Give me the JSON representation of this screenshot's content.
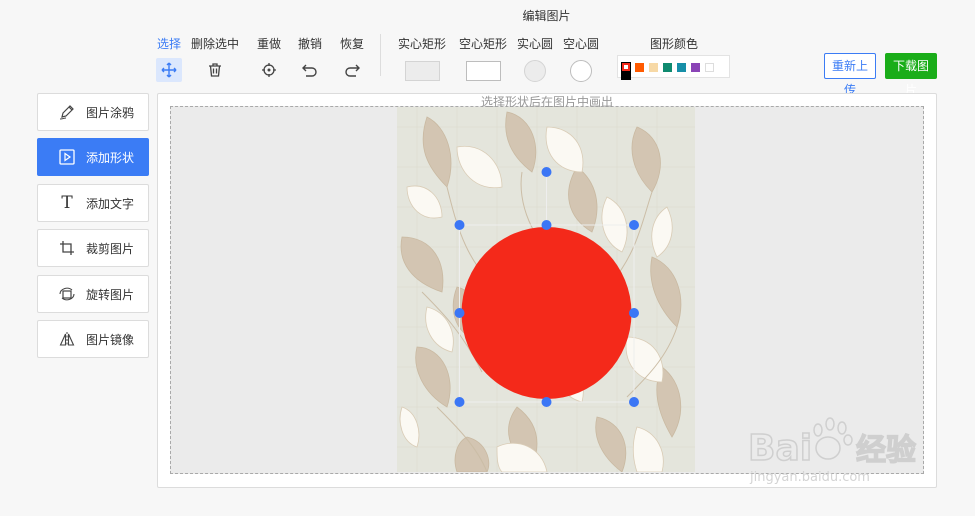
{
  "app": {
    "title": "编辑图片"
  },
  "toolbar": {
    "tools": [
      {
        "label": "选择",
        "icon": "move-icon",
        "active": true
      },
      {
        "label": "删除选中",
        "icon": "trash-icon"
      },
      {
        "label": "重做",
        "icon": "crosshair-icon"
      },
      {
        "label": "撤销",
        "icon": "undo-icon"
      },
      {
        "label": "恢复",
        "icon": "redo-icon"
      }
    ],
    "shapes": [
      {
        "label": "实心矩形",
        "icon": "filled-rect-icon"
      },
      {
        "label": "空心矩形",
        "icon": "hollow-rect-icon"
      },
      {
        "label": "实心圆",
        "icon": "filled-circle-icon"
      },
      {
        "label": "空心圆",
        "icon": "hollow-circle-icon"
      }
    ],
    "color_label": "图形颜色",
    "colors": [
      "#000000",
      "#ff5a00",
      "#f7d9a6",
      "#0f8a6f",
      "#178fa8",
      "#8a44b6",
      "#ffffff"
    ],
    "selected_color": "#f4291a",
    "reupload_label": "重新上传",
    "download_label": "下载图片"
  },
  "sidebar": {
    "items": [
      {
        "label": "图片涂鸦",
        "icon": "pen-icon"
      },
      {
        "label": "添加形状",
        "icon": "shape-icon",
        "active": true
      },
      {
        "label": "添加文字",
        "icon": "text-icon"
      },
      {
        "label": "裁剪图片",
        "icon": "crop-icon"
      },
      {
        "label": "旋转图片",
        "icon": "rotate-icon"
      },
      {
        "label": "图片镜像",
        "icon": "mirror-icon"
      }
    ]
  },
  "canvas": {
    "hint": "选择形状后在图片中画出",
    "shape": {
      "type": "filled-circle",
      "color": "#f4291a"
    }
  },
  "watermark": {
    "brand": "Baidu经验",
    "url": "jingyan.baidu.com"
  }
}
